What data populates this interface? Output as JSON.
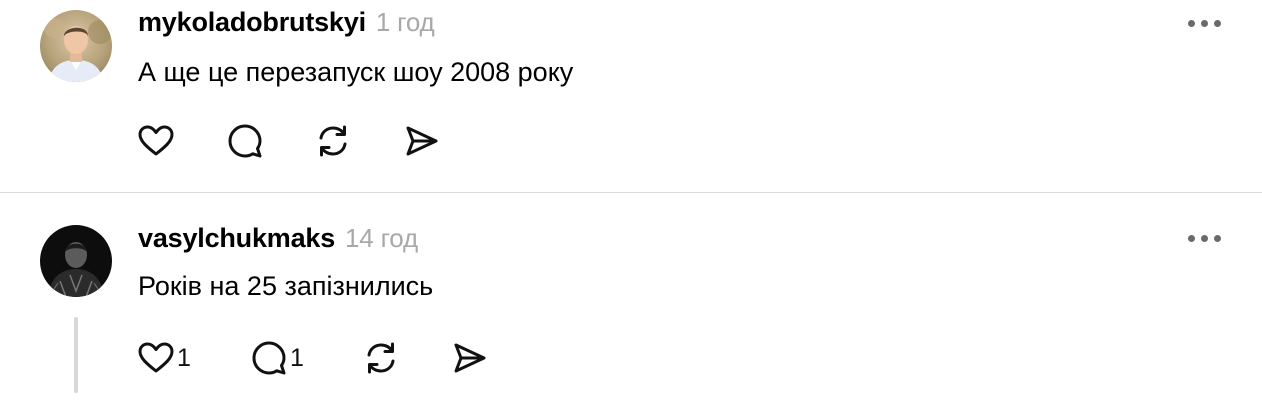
{
  "comments": [
    {
      "username": "mykoladobrutskyi",
      "time": "1 год",
      "text": "А ще це перезапуск шоу 2008 року",
      "like_count": "",
      "reply_count": ""
    },
    {
      "username": "vasylchukmaks",
      "time": "14 год",
      "text": "Років на 25 запізнились",
      "like_count": "1",
      "reply_count": "1"
    }
  ],
  "icons": {
    "like": "heart-icon",
    "reply": "speech-bubble-icon",
    "repost": "repost-arrows-icon",
    "share": "send-icon",
    "more": "more-dots-icon"
  },
  "colors": {
    "timestamp": "#a8a8a8",
    "divider": "#dcdcdc",
    "thread_line": "#d8d8d8",
    "icon": "#111111"
  }
}
